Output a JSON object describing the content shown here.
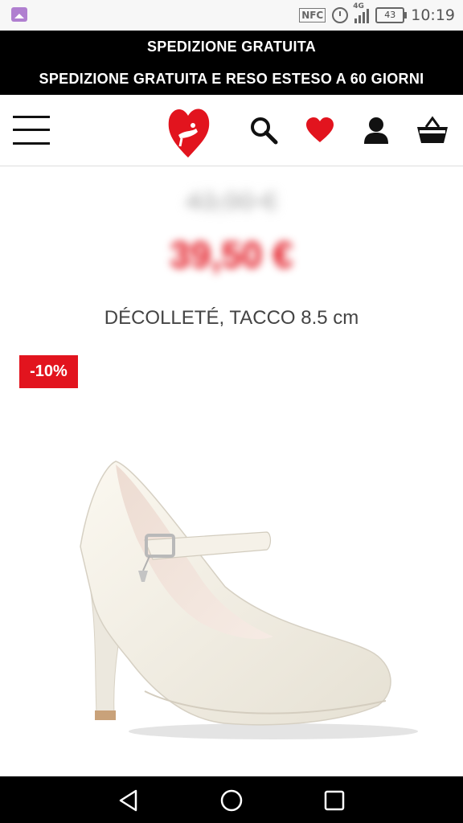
{
  "status_bar": {
    "time": "10:19",
    "battery": "43",
    "network": "4G",
    "nfc": "NFC",
    "icons": [
      "gallery-icon",
      "nfc-icon",
      "alarm-icon",
      "signal-icon",
      "battery-icon"
    ]
  },
  "promo": {
    "line1": "SPEDIZIONE GRATUITA",
    "line2": "SPEDIZIONE GRATUITA E RESO ESTESO A 60 GIORNI"
  },
  "header": {
    "icons": [
      "menu-icon",
      "logo-heart-icon",
      "search-icon",
      "wishlist-heart-icon",
      "account-icon",
      "cart-basket-icon"
    ]
  },
  "product": {
    "old_price": "43,90 €",
    "price": "39,50 €",
    "title": "DÉCOLLETÉ, TACCO 8.5 cm",
    "discount_badge": "-10%"
  },
  "colors": {
    "brand_red": "#e2141e",
    "promo_bg": "#000000",
    "text": "#444444"
  },
  "navbar": {
    "icons": [
      "back-icon",
      "home-icon",
      "recents-icon"
    ]
  }
}
